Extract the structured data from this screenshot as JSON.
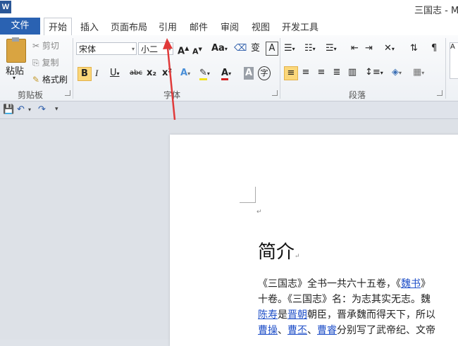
{
  "window": {
    "logo": "W",
    "title": "三国志 - Mi"
  },
  "tabs": {
    "file": "文件",
    "items": [
      "开始",
      "插入",
      "页面布局",
      "引用",
      "邮件",
      "审阅",
      "视图",
      "开发工具"
    ]
  },
  "clipboard": {
    "paste": "粘贴",
    "cut": "剪切",
    "copy": "复制",
    "format_painter": "格式刷",
    "group": "剪贴板"
  },
  "font": {
    "name": "宋体",
    "size": "小二",
    "group": "字体",
    "grow": "A",
    "shrink": "A",
    "change_case": "Aa",
    "clear": "A",
    "bold": "B",
    "italic": "I",
    "underline": "U",
    "strike": "abc",
    "subscript": "x₂",
    "superscript": "x²",
    "color_a": "A",
    "char_shade": "A",
    "enclose": "字"
  },
  "paragraph": {
    "group": "段落"
  },
  "document": {
    "heading": "简介",
    "line1": {
      "a": "《三国志》全书一共六十五卷，《",
      "link": "魏书",
      "b": "》"
    },
    "line2": "十卷。《三国志》名：为志其实无志。魏",
    "line3": {
      "link1": "陈寿",
      "a": "是",
      "link2": "晋朝",
      "b": "朝臣，晋承魏而得天下，所以"
    },
    "line4": {
      "link1": "曹操",
      "a": "、",
      "link2": "曹丕",
      "b": "、",
      "link3": "曹睿",
      "c": "分别写了武帝纪、文帝"
    }
  },
  "colors": {
    "file_tab": "#2a62b2",
    "arrow": "#e03a3a",
    "link": "#1f4fc8",
    "highlight": "#fbd77a"
  }
}
